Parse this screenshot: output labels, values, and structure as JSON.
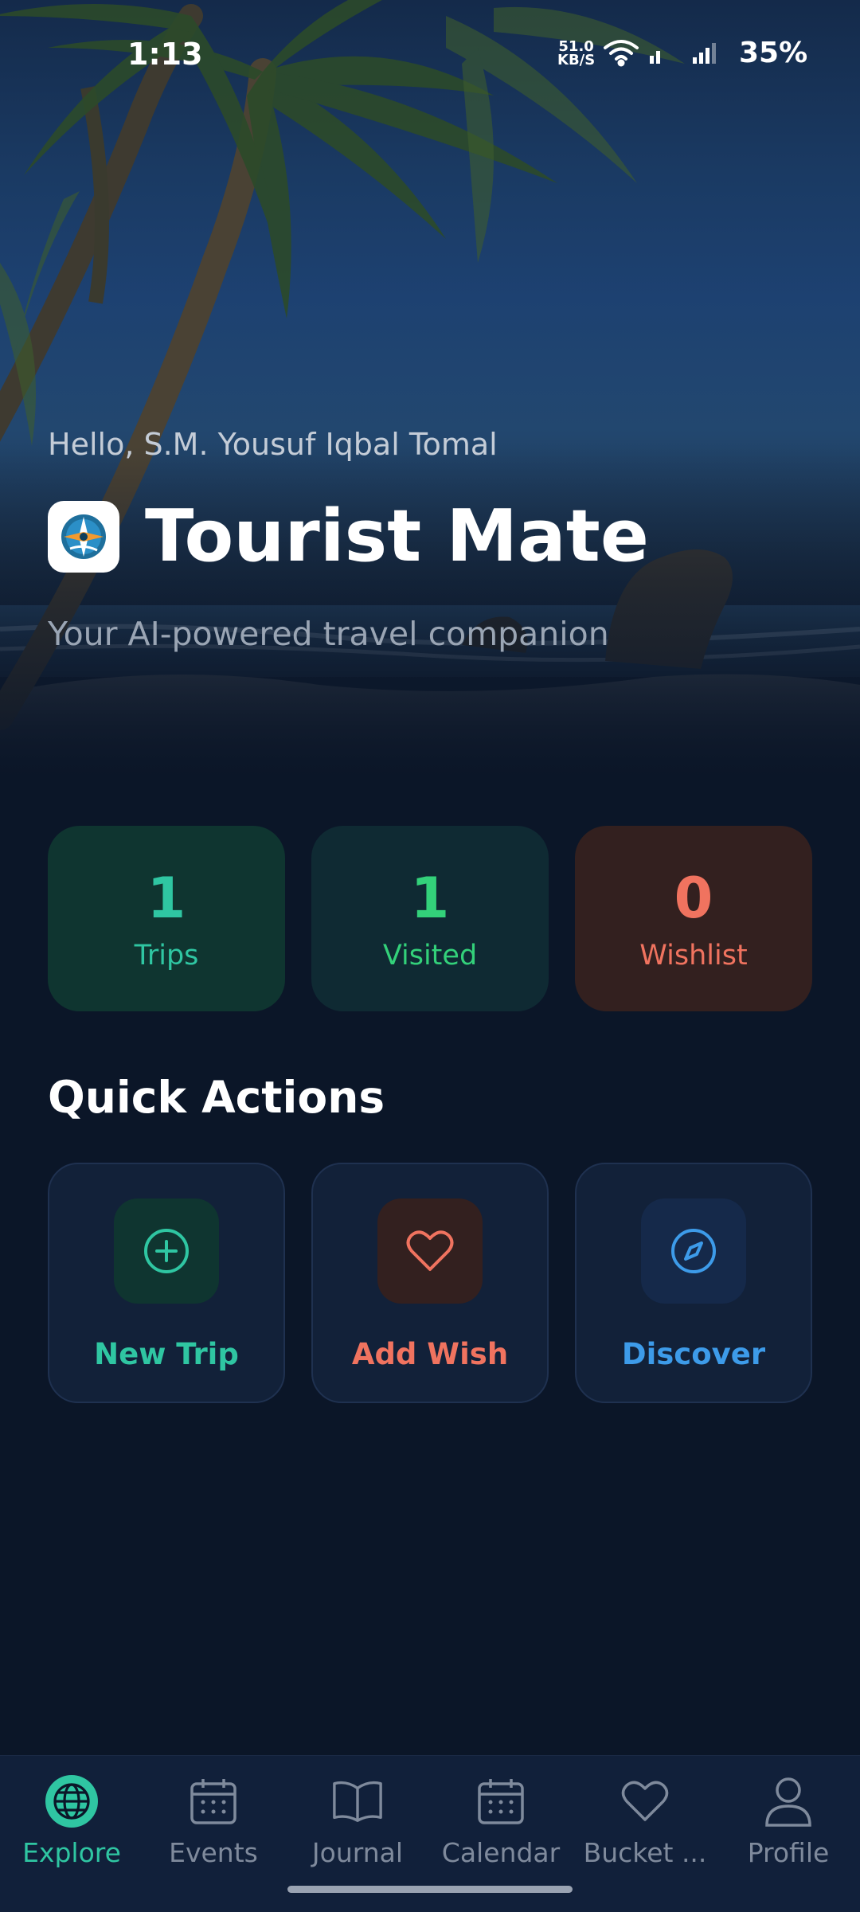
{
  "status_bar": {
    "time": "1:13",
    "net_speed_value": "51.0",
    "net_speed_unit": "KB/S",
    "battery": "35%",
    "icons": [
      "wifi-icon",
      "signal-icon",
      "signal-icon"
    ]
  },
  "header": {
    "greeting": "Hello, S.M. Yousuf Iqbal Tomal",
    "app_title": "Tourist Mate",
    "tagline": "Your AI-powered travel companion",
    "app_icon": "compass-logo-icon"
  },
  "stats": [
    {
      "value": "1",
      "label": "Trips",
      "color": "#2fc6a2"
    },
    {
      "value": "1",
      "label": "Visited",
      "color": "#33d17a"
    },
    {
      "value": "0",
      "label": "Wishlist",
      "color": "#f0735f"
    }
  ],
  "quick_actions": {
    "title": "Quick Actions",
    "items": [
      {
        "label": "New Trip",
        "icon": "plus-circle-icon",
        "color": "#2fc6a2"
      },
      {
        "label": "Add Wish",
        "icon": "heart-icon",
        "color": "#f0735f"
      },
      {
        "label": "Discover",
        "icon": "compass-icon",
        "color": "#3d9be9"
      }
    ]
  },
  "bottom_nav": {
    "active": "Explore",
    "items": [
      {
        "label": "Explore",
        "icon": "globe-icon"
      },
      {
        "label": "Events",
        "icon": "calendar-icon"
      },
      {
        "label": "Journal",
        "icon": "book-icon"
      },
      {
        "label": "Calendar",
        "icon": "calendar-icon"
      },
      {
        "label": "Bucket ...",
        "icon": "heart-icon"
      },
      {
        "label": "Profile",
        "icon": "user-icon"
      }
    ]
  },
  "colors": {
    "background": "#0b1628",
    "accent": "#2fc6a2",
    "nav_inactive": "#7f8a9c"
  }
}
